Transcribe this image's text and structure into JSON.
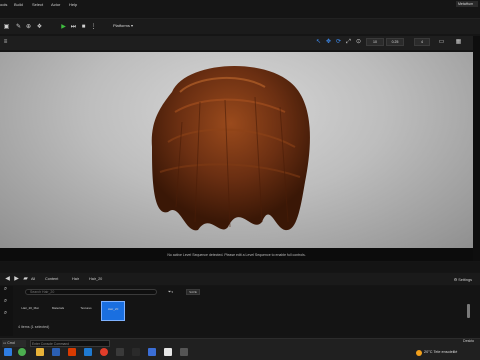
{
  "menu": {
    "items": [
      "ools",
      "Build",
      "Select",
      "Actor",
      "Help"
    ],
    "window_title": "MetaHum"
  },
  "toolbar": {
    "platforms_label": "Platforms"
  },
  "viewport_bar": {
    "chips": [
      "10",
      "0.25",
      "4"
    ]
  },
  "viewport": {
    "sequence_message": "No active Level Sequence detected. Please edit a Level Sequence to enable full controls."
  },
  "content_browser": {
    "breadcrumbs": [
      "All",
      "Content",
      "Hair",
      "Hair_20"
    ],
    "settings_label": "Settings",
    "search_placeholder": "Search Hair_20",
    "save_label": "SAVE",
    "assets": [
      {
        "label": "Hair_20_Mat"
      },
      {
        "label": "Materials"
      },
      {
        "label": "Textures"
      },
      {
        "label": "Hair_20"
      }
    ],
    "items_status": "4 items (1 selected)"
  },
  "console": {
    "label": "Cmd",
    "placeholder": "Enter Console Command"
  },
  "taskbar": {
    "weather_temp": "20°C",
    "weather_text": "Tele ensoleillé",
    "desktop_label": "Deskto"
  },
  "colors": {
    "accent_selected": "#1a6fe0",
    "play_green": "#3fbf3f",
    "hair_base": "#6b2f12"
  }
}
